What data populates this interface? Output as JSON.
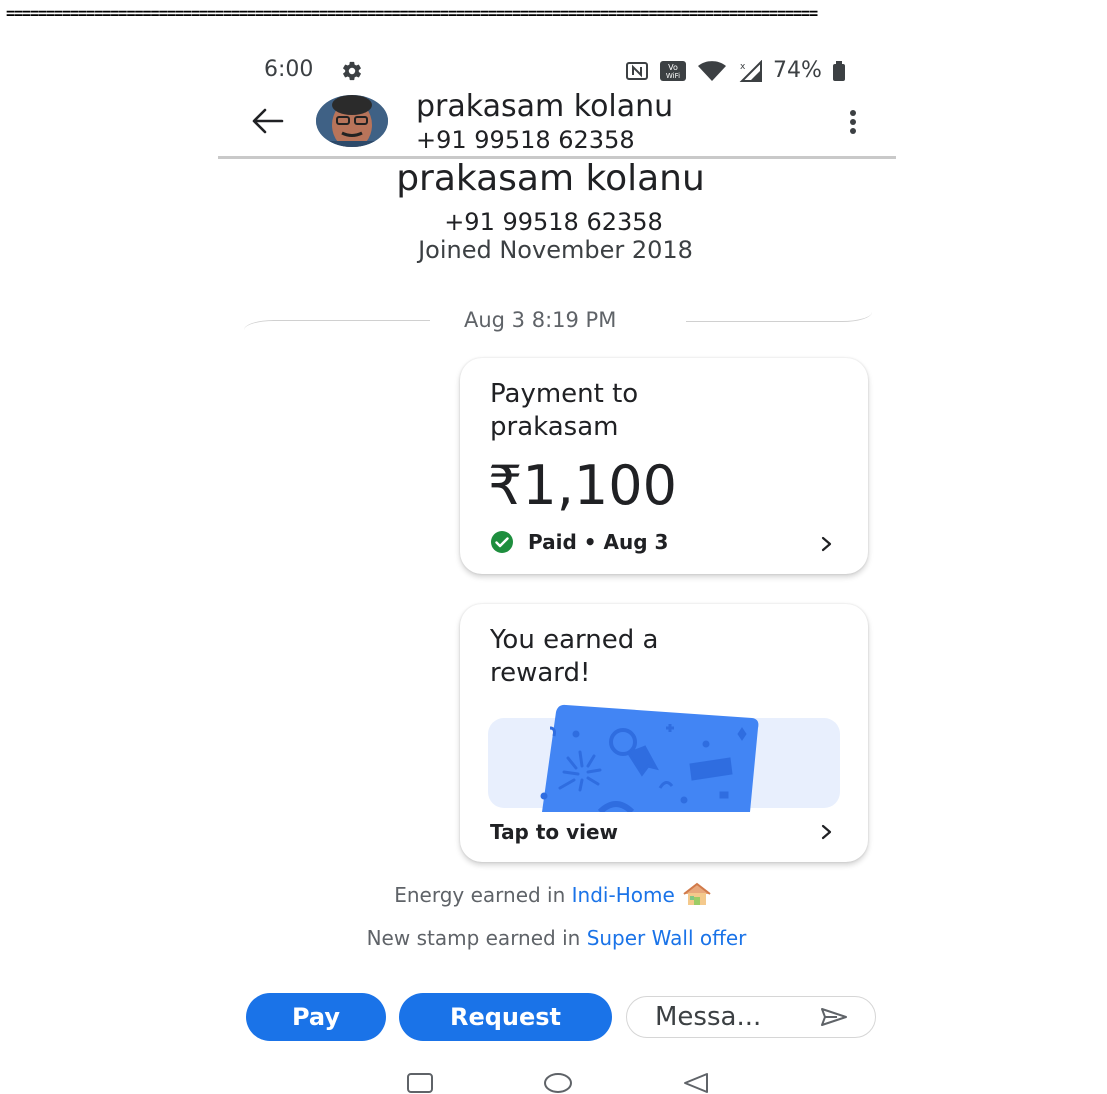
{
  "top_border": "=====================================================================================================",
  "status_bar": {
    "time": "6:00",
    "battery": "74%",
    "icons": [
      "gear-icon",
      "nfc-icon",
      "vowifi-icon",
      "wifi-icon",
      "signal-icon",
      "battery-icon"
    ]
  },
  "header": {
    "name": "prakasam kolanu",
    "phone": "+91 99518 62358"
  },
  "profile": {
    "name": "prakasam kolanu",
    "phone": "+91 99518 62358",
    "joined": "Joined November 2018"
  },
  "conversation": {
    "date_separator": "Aug 3 8:19 PM",
    "payment_card": {
      "title_line1": "Payment to",
      "title_line2": "prakasam",
      "amount": "₹1,100",
      "status": "Paid • Aug 3",
      "status_color": "#1e8e3e"
    },
    "reward_card": {
      "title_line1": "You earned a",
      "title_line2": "reward!",
      "cta": "Tap to view"
    },
    "activity": [
      {
        "prefix": "Energy earned in ",
        "link": "Indi-Home"
      },
      {
        "prefix": "New stamp earned in ",
        "link": "Super Wall offer"
      }
    ]
  },
  "actions": {
    "pay_label": "Pay",
    "request_label": "Request",
    "message_text": "Messa..."
  },
  "colors": {
    "accent": "#1a73e8",
    "success": "#1e8e3e",
    "reward_card": "#4285f4"
  }
}
